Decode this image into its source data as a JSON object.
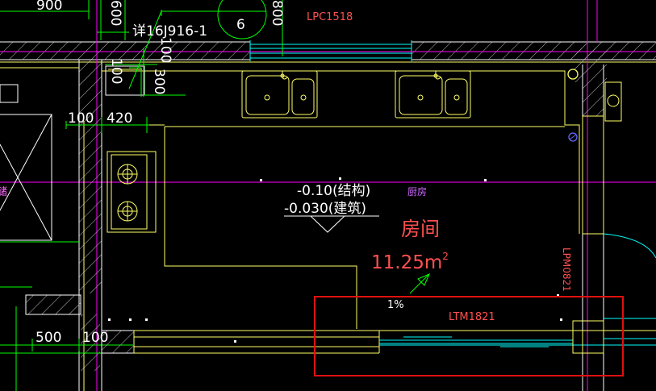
{
  "colors": {
    "background": "#000000",
    "wall_line": "#ffffff",
    "hatch": "#c8c8c8",
    "dim_green": "#00ff00",
    "fixture_yellow": "#ffff66",
    "axis_magenta": "#ff00ff",
    "label_red": "#ff5050",
    "window_cyan": "#00ffff",
    "level_white": "#ffffff",
    "room_purple": "#cc66ff",
    "highlight_red": "#e01010",
    "circle_blue": "#6666ff"
  },
  "dimensions": {
    "top_900": "900",
    "vertical_600": "600",
    "vertical_800": "800",
    "detail_ref": "详16J916-1",
    "detail_circle_number": "6",
    "ref_100_left": "100",
    "ref_300": "300",
    "ref_100_mid": "100",
    "wall_100": "100",
    "wall_420": "420",
    "bottom_500": "500",
    "bottom_100": "100"
  },
  "labels": {
    "window_top": "LPC1518",
    "door_right": "LPM0821",
    "door_bottom": "LTM1821",
    "level_structure": "-0.10(结构)",
    "level_architecture": "-0.030(建筑)",
    "room_tag": "厨房",
    "room_name": "房间",
    "room_area": "11.25m",
    "room_area_sup": "2",
    "slope": "1%",
    "cut_left": "储"
  }
}
